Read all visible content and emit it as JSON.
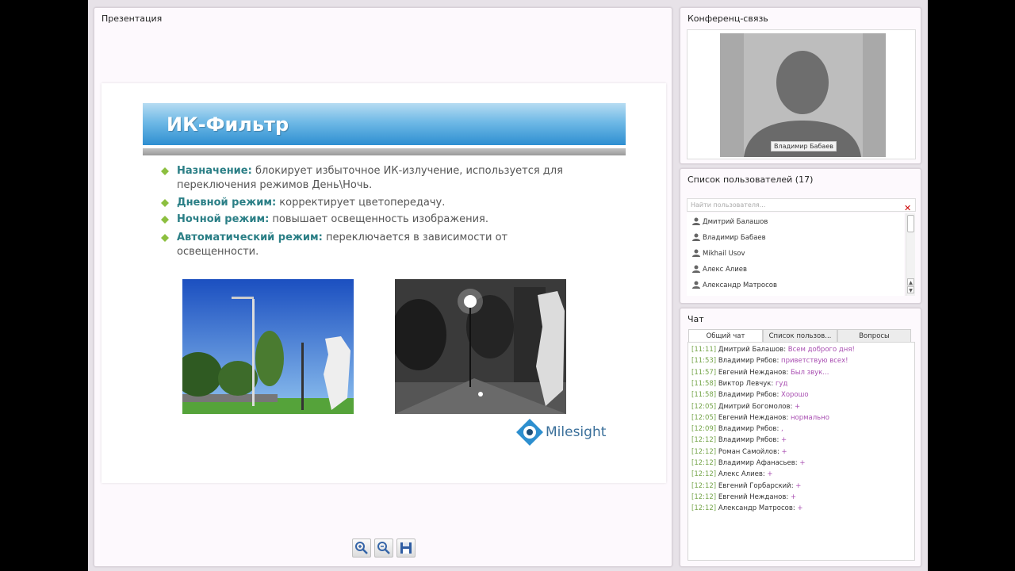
{
  "presentation": {
    "title": "Презентация",
    "slide": {
      "heading": "ИК-Фильтр",
      "bullets": [
        {
          "term": "Назначение:",
          "text": "блокирует избыточное ИК-излучение, используется для переключения режимов День\\Ночь."
        },
        {
          "term": "Дневной режим:",
          "text": "корректирует цветопередачу."
        },
        {
          "term": "Ночной режим:",
          "text": "повышает освещенность изображения."
        },
        {
          "term": "Автоматический режим:",
          "text": "переключается в зависимости от освещенности."
        }
      ],
      "logo_text": "Milesight"
    },
    "toolbar": [
      "zoom-in-icon",
      "zoom-out-icon",
      "save-icon"
    ]
  },
  "conference": {
    "title": "Конференц-связь",
    "speaker_name": "Владимир Бабаев"
  },
  "users": {
    "title": "Список пользователей (17)",
    "search_placeholder": "Найти пользователя...",
    "list": [
      "Дмитрий Балашов",
      "Владимир Бабаев",
      "Mikhail Usov",
      "Алекс Алиев",
      "Александр Матросов"
    ]
  },
  "chat": {
    "title": "Чат",
    "tabs": [
      "Общий чат",
      "Список пользов...",
      "Вопросы"
    ],
    "messages": [
      {
        "time": "[11:11]",
        "user": "Дмитрий Балашов:",
        "text": "Всем доброго дня!"
      },
      {
        "time": "[11:53]",
        "user": "Владимир Рябов:",
        "text": "приветствую всех!"
      },
      {
        "time": "[11:57]",
        "user": "Евгений Нежданов:",
        "text": "Был звук..."
      },
      {
        "time": "[11:58]",
        "user": "Виктор Левчук:",
        "text": "гуд"
      },
      {
        "time": "[11:58]",
        "user": "Владимир Рябов:",
        "text": "Хорошо"
      },
      {
        "time": "[12:05]",
        "user": "Дмитрий Богомолов:",
        "text": "+"
      },
      {
        "time": "[12:05]",
        "user": "Евгений Нежданов:",
        "text": "нормально"
      },
      {
        "time": "[12:09]",
        "user": "Владимир Рябов:",
        "text": ","
      },
      {
        "time": "[12:12]",
        "user": "Владимир Рябов:",
        "text": "+"
      },
      {
        "time": "[12:12]",
        "user": "Роман Самойлов:",
        "text": "+"
      },
      {
        "time": "[12:12]",
        "user": "Владимир Афанасьев:",
        "text": "+"
      },
      {
        "time": "[12:12]",
        "user": "Алекс Алиев:",
        "text": "+"
      },
      {
        "time": "[12:12]",
        "user": "Евгений Горбарский:",
        "text": "+"
      },
      {
        "time": "[12:12]",
        "user": "Евгений Нежданов:",
        "text": "+"
      },
      {
        "time": "[12:12]",
        "user": "Александр Матросов:",
        "text": "+"
      }
    ]
  }
}
